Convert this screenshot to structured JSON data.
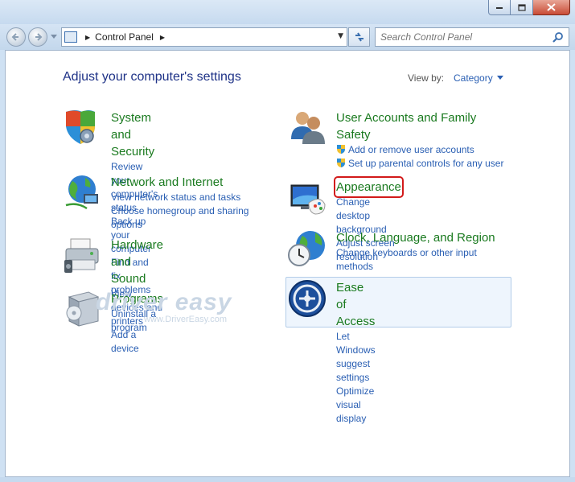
{
  "window": {
    "address": {
      "segment": "Control Panel"
    },
    "search": {
      "placeholder": "Search Control Panel"
    }
  },
  "main": {
    "heading": "Adjust your computer's settings",
    "view_by_label": "View by:",
    "view_by_value": "Category",
    "highlighted_item": "Appearance",
    "left_categories": [
      {
        "title": "System and Security",
        "icon": "security-shield-icon",
        "links": [
          "Review your computer's status",
          "Back up your computer",
          "Find and fix problems"
        ]
      },
      {
        "title": "Network and Internet",
        "icon": "network-globe-icon",
        "links": [
          "View network status and tasks",
          "Choose homegroup and sharing options"
        ]
      },
      {
        "title": "Hardware and Sound",
        "icon": "printer-icon",
        "links": [
          "View devices and printers",
          "Add a device"
        ]
      },
      {
        "title": "Programs",
        "icon": "programs-box-icon",
        "links": [
          "Uninstall a program"
        ]
      }
    ],
    "right_categories": [
      {
        "title": "User Accounts and Family Safety",
        "icon": "users-icon",
        "links": [
          "Add or remove user accounts",
          "Set up parental controls for any user"
        ]
      },
      {
        "title": "Appearance",
        "icon": "monitor-palette-icon",
        "links": [
          "Change desktop background",
          "Adjust screen resolution"
        ]
      },
      {
        "title": "Clock, Language, and Region",
        "icon": "clock-globe-icon",
        "links": [
          "Change keyboards or other input methods"
        ]
      },
      {
        "title": "Ease of Access",
        "icon": "ease-of-access-icon",
        "links": [
          "Let Windows suggest settings",
          "Optimize visual display"
        ]
      }
    ],
    "watermark": {
      "brand": "driver easy",
      "url": "www.DriverEasy.com"
    }
  },
  "colors": {
    "category_title": "#1a7a1f",
    "link": "#2a5fb3",
    "heading": "#1e3287",
    "highlight": "#d21a1a"
  }
}
